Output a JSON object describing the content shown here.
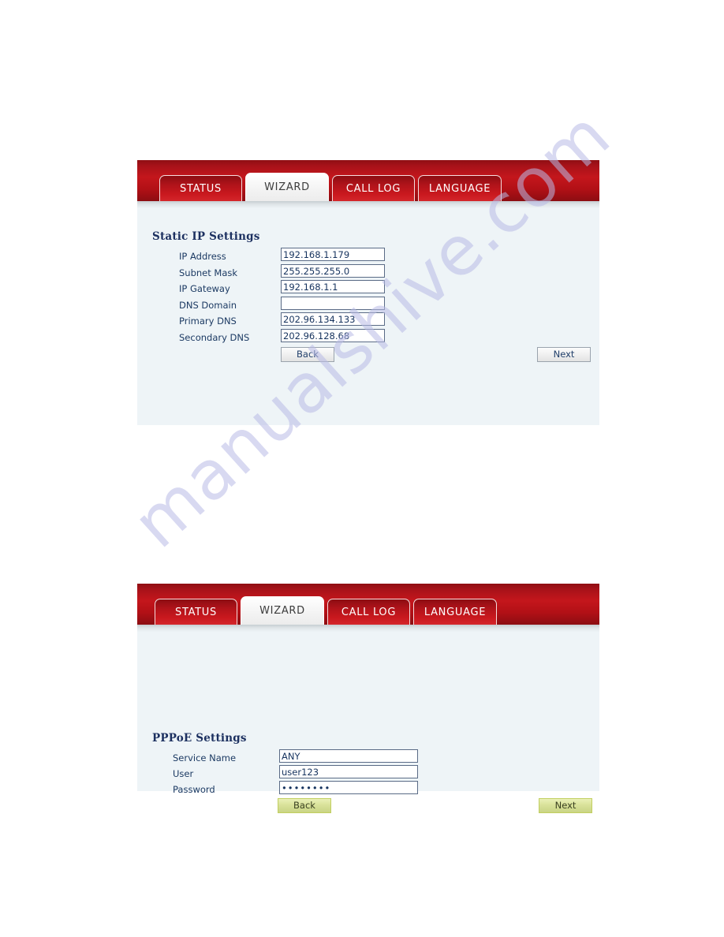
{
  "document": {
    "watermark_text": "manualshive.com"
  },
  "panels": [
    {
      "id": "static-ip",
      "tabs": [
        {
          "label": "STATUS",
          "active": false
        },
        {
          "label": "WIZARD",
          "active": true
        },
        {
          "label": "CALL LOG",
          "active": false
        },
        {
          "label": "LANGUAGE",
          "active": false
        }
      ],
      "section_title": "Static IP Settings",
      "fields": [
        {
          "label": "IP Address",
          "value": "192.168.1.179"
        },
        {
          "label": "Subnet Mask",
          "value": "255.255.255.0"
        },
        {
          "label": "IP Gateway",
          "value": "192.168.1.1"
        },
        {
          "label": "DNS Domain",
          "value": ""
        },
        {
          "label": "Primary DNS",
          "value": "202.96.134.133"
        },
        {
          "label": "Secondary DNS",
          "value": "202.96.128.68"
        }
      ],
      "buttons": {
        "back": "Back",
        "next": "Next"
      }
    },
    {
      "id": "pppoe",
      "tabs": [
        {
          "label": "STATUS",
          "active": false
        },
        {
          "label": "WIZARD",
          "active": true
        },
        {
          "label": "CALL LOG",
          "active": false
        },
        {
          "label": "LANGUAGE",
          "active": false
        }
      ],
      "section_title": "PPPoE Settings",
      "fields": [
        {
          "label": "Service Name",
          "value": "ANY"
        },
        {
          "label": "User",
          "value": "user123"
        },
        {
          "label": "Password",
          "value": "••••••••"
        }
      ],
      "buttons": {
        "back": "Back",
        "next": "Next"
      }
    }
  ],
  "colors": {
    "header_red": "#c4161c",
    "panel_background": "#eef4f7",
    "label_navy": "#1c3a63",
    "button_green": "#d9e29a",
    "watermark_purple": "#b9bbe6"
  }
}
